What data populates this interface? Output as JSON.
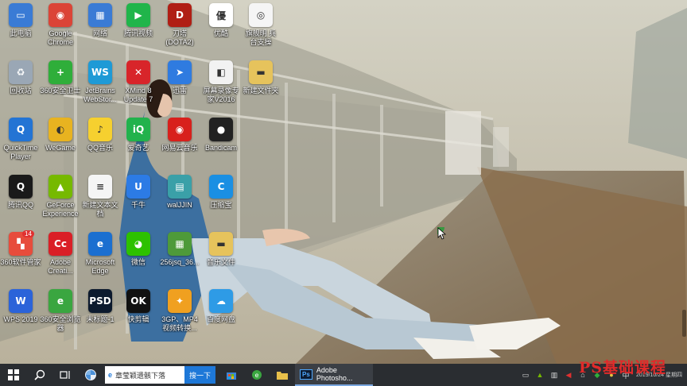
{
  "desktop": {
    "icons": [
      {
        "label": "此电脑",
        "icon": "computer-icon",
        "color": "#3a7bd5",
        "glyph": "▭"
      },
      {
        "label": "Google\nChrome",
        "icon": "chrome-icon",
        "color": "#db4437",
        "glyph": "◉"
      },
      {
        "label": "网络",
        "icon": "network-icon",
        "color": "#3a7bd5",
        "glyph": "▦"
      },
      {
        "label": "腾讯视频",
        "icon": "tencent-video-icon",
        "color": "#20b54a",
        "glyph": "▶"
      },
      {
        "label": "刀塔\n(DOTA2)",
        "icon": "dota2-icon",
        "color": "#b01e14",
        "glyph": "D"
      },
      {
        "label": "优酷",
        "icon": "youku-icon",
        "color": "#ffffff",
        "glyph": "優"
      },
      {
        "label": "旗舰明    兵\n台支操",
        "icon": "document-icon",
        "color": "#f5f5f5",
        "glyph": "◎"
      },
      {
        "label": "回收站",
        "icon": "recycle-bin-icon",
        "color": "#9aa7b5",
        "glyph": "♻"
      },
      {
        "label": "360安全卫士",
        "icon": "360-security-icon",
        "color": "#2fae3a",
        "glyph": "+"
      },
      {
        "label": "JetBrains\nWebStor...",
        "icon": "webstorm-icon",
        "color": "#1e9ad6",
        "glyph": "WS"
      },
      {
        "label": "XMind 8\nUpdate 7",
        "icon": "xmind-icon",
        "color": "#d8252a",
        "glyph": "✕"
      },
      {
        "label": "迅雷",
        "icon": "xunlei-icon",
        "color": "#2f7be0",
        "glyph": "➤"
      },
      {
        "label": "屏幕录像专\n家V2016",
        "icon": "screen-recorder-icon",
        "color": "#f2f2f2",
        "glyph": "◧"
      },
      {
        "label": "新建文件夹",
        "icon": "folder-icon",
        "color": "#e6c35c",
        "glyph": "▬"
      },
      {
        "label": "QuickTime\nPlayer",
        "icon": "quicktime-icon",
        "color": "#2374d4",
        "glyph": "Q"
      },
      {
        "label": "WeGame",
        "icon": "wegame-icon",
        "color": "#e8b320",
        "glyph": "◐"
      },
      {
        "label": "QQ音乐",
        "icon": "qq-music-icon",
        "color": "#f6d02f",
        "glyph": "♪"
      },
      {
        "label": "爱奇艺",
        "icon": "iqiyi-icon",
        "color": "#22b24c",
        "glyph": "iQ"
      },
      {
        "label": "网易云音乐",
        "icon": "netease-music-icon",
        "color": "#d8201c",
        "glyph": "◉"
      },
      {
        "label": "Bandicam",
        "icon": "bandicam-icon",
        "color": "#222222",
        "glyph": "●"
      },
      {
        "label": "腾讯QQ",
        "icon": "qq-icon",
        "color": "#1a1a1a",
        "glyph": "Q"
      },
      {
        "label": "GeForce\nExperience",
        "icon": "geforce-icon",
        "color": "#76b900",
        "glyph": "▲"
      },
      {
        "label": "新建文本文\n档",
        "icon": "text-document-icon",
        "color": "#f5f5f5",
        "glyph": "≡"
      },
      {
        "label": "千牛",
        "icon": "qianniu-icon",
        "color": "#2c7be5",
        "glyph": "U"
      },
      {
        "label": "walJJIN",
        "icon": "archive-icon",
        "color": "#3aa0a8",
        "glyph": "▤"
      },
      {
        "label": "压缩宝",
        "icon": "compress-icon",
        "color": "#1a8fe3",
        "glyph": "C"
      },
      {
        "label": "360软件管家",
        "icon": "360-software-icon",
        "color": "#e74c3c",
        "glyph": "▚",
        "badge": "14"
      },
      {
        "label": "Adobe\nCreati...",
        "icon": "adobe-cc-icon",
        "color": "#da1f26",
        "glyph": "Cc"
      },
      {
        "label": "Microsoft\nEdge",
        "icon": "edge-icon",
        "color": "#1b6fd0",
        "glyph": "e"
      },
      {
        "label": "微信",
        "icon": "wechat-icon",
        "color": "#2dc100",
        "glyph": "◕"
      },
      {
        "label": "256jsq_36...",
        "icon": "installer-icon",
        "color": "#4e9a3a",
        "glyph": "▦"
      },
      {
        "label": "音乐文件",
        "icon": "music-folder-icon",
        "color": "#e6c35c",
        "glyph": "▬"
      },
      {
        "label": "WPS 2019",
        "icon": "wps-icon",
        "color": "#2b63d9",
        "glyph": "W"
      },
      {
        "label": "360安全浏览\n器",
        "icon": "360-browser-icon",
        "color": "#3aa640",
        "glyph": "e"
      },
      {
        "label": "未标题-1",
        "icon": "psd-file-icon",
        "color": "#0c1a2e",
        "glyph": "PSD"
      },
      {
        "label": "快剪辑",
        "icon": "kuaijianji-icon",
        "color": "#111111",
        "glyph": "OK"
      },
      {
        "label": "3GP、MP4\n视频转换...",
        "icon": "video-converter-icon",
        "color": "#f0a020",
        "glyph": "✦"
      },
      {
        "label": "百度网盘",
        "icon": "baidu-netdisk-icon",
        "color": "#2e9be6",
        "glyph": "☁"
      }
    ]
  },
  "taskbar": {
    "search_placeholder": "章莹颖遗骸下落",
    "search_button": "搜一下",
    "active_app_label": "Adobe Photosho...",
    "clock": "2019/10/24 星期四",
    "ime": "中"
  },
  "watermark": "PS基础课程"
}
